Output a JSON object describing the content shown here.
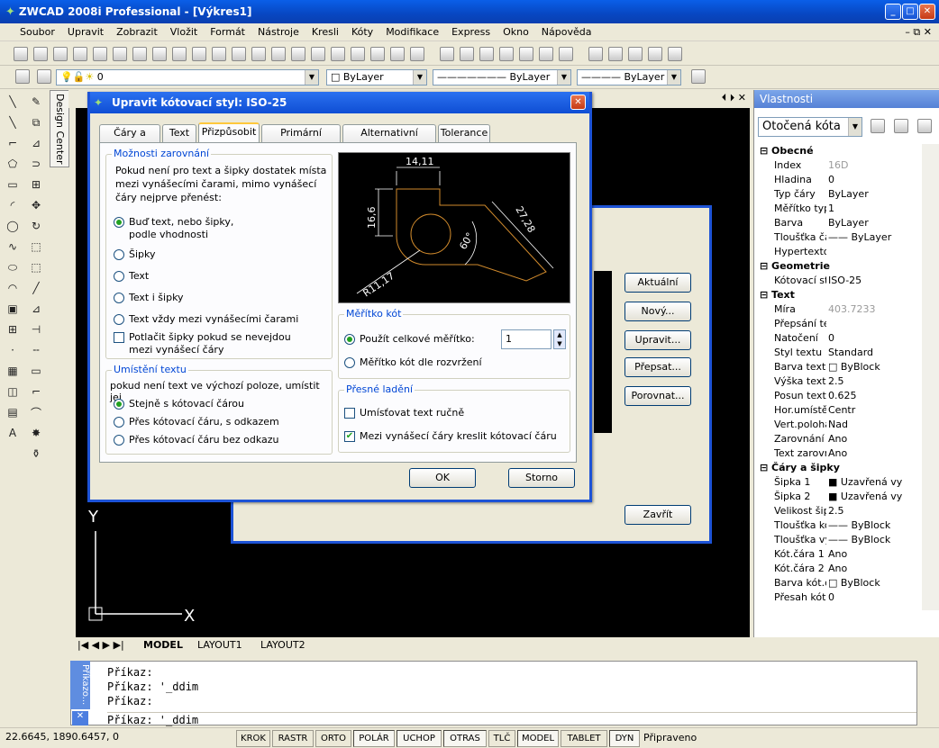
{
  "app": {
    "title": "ZWCAD 2008i Professional - [Výkres1]"
  },
  "menu": [
    "Soubor",
    "Upravit",
    "Zobrazit",
    "Vložit",
    "Formát",
    "Nástroje",
    "Kresli",
    "Kóty",
    "Modifikace",
    "Express",
    "Okno",
    "Nápověda"
  ],
  "layerbar": {
    "layer": "0",
    "color": "ByLayer",
    "linetype": "ByLayer",
    "lineweight": "ByLayer"
  },
  "leftpanel": {
    "design_center": "Design Center"
  },
  "props": {
    "title": "Vlastnosti",
    "selection": "Otočená kóta",
    "rows": [
      {
        "cat": "Obecné"
      },
      {
        "k": "Index",
        "v": "16D",
        "grey": true
      },
      {
        "k": "Hladina",
        "v": "0"
      },
      {
        "k": "Typ čáry",
        "v": "ByLayer"
      },
      {
        "k": "Měřítko typu čár",
        "v": "1"
      },
      {
        "k": "Barva",
        "v": "ByLayer"
      },
      {
        "k": "Tloušťka čáry",
        "v": "—— ByLayer"
      },
      {
        "k": "Hypertextový od",
        "v": ""
      },
      {
        "cat": "Geometrie"
      },
      {
        "k": "Kótovací styl",
        "v": "ISO-25"
      },
      {
        "cat": "Text"
      },
      {
        "k": "Míra",
        "v": "403.7233",
        "grey": true
      },
      {
        "k": "Přepsání textu",
        "v": ""
      },
      {
        "k": "Natočení",
        "v": "0"
      },
      {
        "k": "Styl textu",
        "v": "Standard"
      },
      {
        "k": "Barva textu",
        "v": "□ ByBlock"
      },
      {
        "k": "Výška textu",
        "v": "2.5"
      },
      {
        "k": "Posun textu",
        "v": "0.625"
      },
      {
        "k": "Hor.umístění tex",
        "v": "Centr"
      },
      {
        "k": "Vert.poloha text",
        "v": "Nad"
      },
      {
        "k": "Zarovnání textu",
        "v": "Ano"
      },
      {
        "k": "Text zarovnán n",
        "v": "Ano"
      },
      {
        "cat": "Čáry a šipky"
      },
      {
        "k": "Šipka 1",
        "v": "■ Uzavřená vyp"
      },
      {
        "k": "Šipka 2",
        "v": "■ Uzavřená vyp"
      },
      {
        "k": "Velikost šipky",
        "v": "2.5"
      },
      {
        "k": "Tloušťka kót.čár",
        "v": "—— ByBlock"
      },
      {
        "k": "Tloušťka vyn.čá",
        "v": "—— ByBlock"
      },
      {
        "k": "Kót.čára 1",
        "v": "Ano"
      },
      {
        "k": "Kót.čára 2",
        "v": "Ano"
      },
      {
        "k": "Barva kót.čáry",
        "v": "□ ByBlock"
      },
      {
        "k": "Přesah kót.čáry",
        "v": "0"
      }
    ]
  },
  "layouts": [
    "MODEL",
    "LAYOUT1",
    "LAYOUT2"
  ],
  "command": {
    "tab": "Příkazo...",
    "lines": [
      "Příkaz:",
      "Příkaz: '_ddim",
      "Příkaz:"
    ],
    "input": "Příkaz: '_ddim"
  },
  "status": {
    "coords": "22.6645,  1890.6457,  0",
    "buttons": [
      "KROK",
      "RASTR",
      "ORTO",
      "POLÁR",
      "UCHOP",
      "OTRAS",
      "TLČ",
      "MODEL",
      "TABLET",
      "DYN"
    ],
    "ready": "Připraveno"
  },
  "behind_dialog": {
    "buttons": [
      "Aktuální",
      "Nový...",
      "Upravit...",
      "Přepsat...",
      "Porovnat..."
    ],
    "close": "Zavřít"
  },
  "dialog": {
    "title": "Upravit kótovací styl: ISO-25",
    "tabs": [
      "Čáry a šipky",
      "Text",
      "Přizpůsobit",
      "Primární jednotky",
      "Alternativní jednotky",
      "Tolerance"
    ],
    "fit_group": {
      "legend": "Možnosti zarovnání",
      "desc": "Pokud není pro text a šipky dostatek místa mezi vynášecími čarami, mimo vynášecí čáry nejprve přenést:",
      "opt1": "Buď text, nebo šipky, podle vhodnosti",
      "opt2": "Šipky",
      "opt3": "Text",
      "opt4": "Text i šipky",
      "opt5": "Text vždy mezi vynášecími čarami",
      "suppress": "Potlačit šipky pokud se nevejdou mezi vynášecí čáry"
    },
    "text_group": {
      "legend": "Umístění textu",
      "desc": "pokud není text ve výchozí poloze, umístit jej",
      "opt1": "Stejně s kótovací čárou",
      "opt2": "Přes kótovací čáru, s odkazem",
      "opt3": "Přes kótovací čáru bez odkazu"
    },
    "scale_group": {
      "legend": "Měřítko kót",
      "opt1": "Použít celkové měřítko:",
      "value": "1",
      "opt2": "Měřítko kót dle rozvržení"
    },
    "fine_group": {
      "legend": "Přesné ladění",
      "chk1": "Umísťovat text ručně",
      "chk2": "Mezi vynášecí čáry kreslit kótovací čáru"
    },
    "preview": {
      "d1": "14,11",
      "d2": "16,6",
      "d3": "27,28",
      "d4": "60°",
      "d5": "R11,17"
    },
    "ok": "OK",
    "cancel": "Storno"
  }
}
